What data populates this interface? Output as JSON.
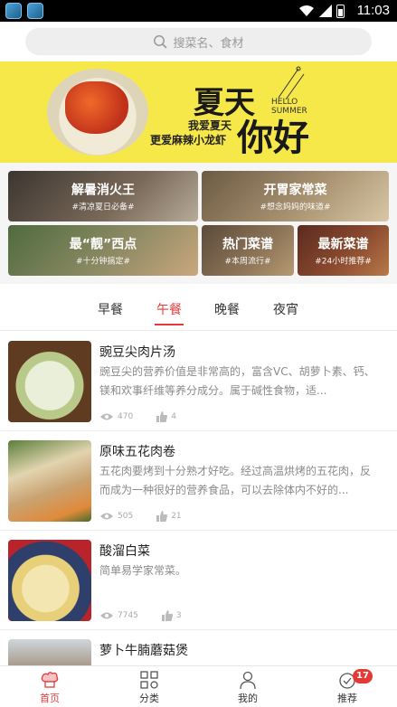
{
  "status_bar": {
    "time": "11:03"
  },
  "search": {
    "placeholder": "搜菜名、食材"
  },
  "banner": {
    "tagline_1": "我爱夏天",
    "tagline_2": "更爱麻辣小龙虾",
    "headline_1": "夏天",
    "headline_2": "你好",
    "hello": "HELLO",
    "summer": "SUMMER"
  },
  "categories": [
    {
      "title": "解暑消火王",
      "subtitle": "#清凉夏日必备#"
    },
    {
      "title": "开胃家常菜",
      "subtitle": "#想念妈妈的味道#"
    },
    {
      "title": "最“靓”西点",
      "subtitle": "#十分钟搞定#"
    },
    {
      "title": "热门菜谱",
      "subtitle": "#本周流行#"
    },
    {
      "title": "最新菜谱",
      "subtitle": "#24小时推荐#"
    }
  ],
  "meal_tabs": [
    "早餐",
    "午餐",
    "晚餐",
    "夜宵"
  ],
  "active_tab": "午餐",
  "recipes": [
    {
      "title": "豌豆尖肉片汤",
      "desc": "豌豆尖的营养价值是非常高的，富含VC、胡萝卜素、钙、镁和欢事纤维等养分成分。属于碱性食物，适...",
      "views": "470",
      "likes": "4"
    },
    {
      "title": "原味五花肉卷",
      "desc": "五花肉要烤到十分熟才好吃。经过高温烘烤的五花肉，反而成为一种很好的营养食品，可以去除体内不好的...",
      "views": "505",
      "likes": "21"
    },
    {
      "title": "酸溜白菜",
      "desc": "简单易学家常菜。",
      "views": "7745",
      "likes": "3"
    },
    {
      "title": "萝卜牛腩蘑菇煲",
      "desc": "",
      "views": "",
      "likes": ""
    }
  ],
  "bottom_nav": [
    {
      "label": "首页"
    },
    {
      "label": "分类"
    },
    {
      "label": "我的"
    },
    {
      "label": "推荐",
      "badge": "17"
    }
  ],
  "colors": {
    "accent": "#e33b3b",
    "banner_bg": "#f7e84a",
    "badge": "#e53935"
  },
  "icons": [
    "wifi-icon",
    "signal-icon",
    "battery-icon",
    "search-icon",
    "eye-icon",
    "thumb-up-icon",
    "chef-hat-icon",
    "grid-icon",
    "person-icon",
    "recommend-icon"
  ]
}
